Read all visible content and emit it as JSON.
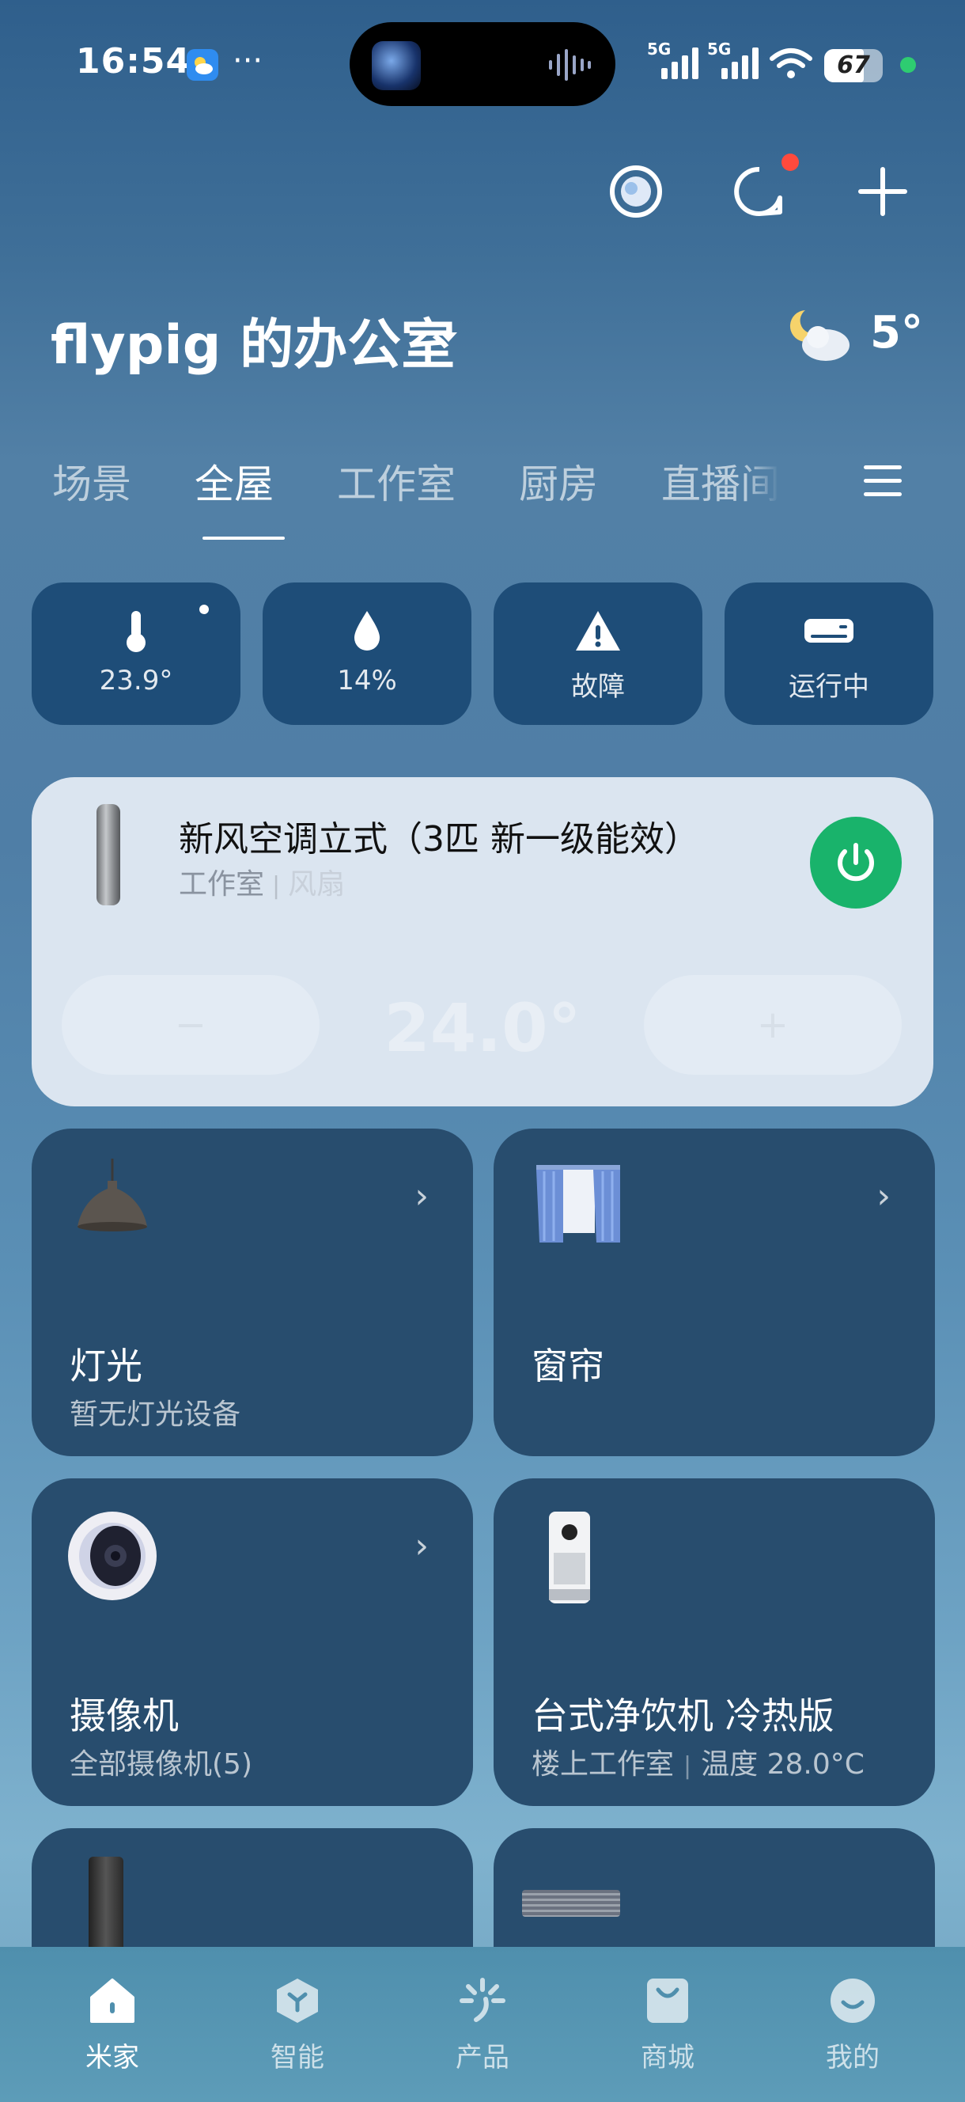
{
  "status_bar": {
    "time": "16:54",
    "dots": "···",
    "net1": "5G",
    "net2": "5G",
    "battery": "67"
  },
  "header": {
    "home_name": "flypig 的办公室",
    "outdoor_temp": "5°"
  },
  "tabs": [
    {
      "label": "场景",
      "active": false
    },
    {
      "label": "全屋",
      "active": true
    },
    {
      "label": "工作室",
      "active": false
    },
    {
      "label": "厨房",
      "active": false
    },
    {
      "label": "直播间",
      "active": false
    }
  ],
  "stats": [
    {
      "icon": "thermometer-icon",
      "value": "23.9°"
    },
    {
      "icon": "humidity-drop-icon",
      "value": "14%"
    },
    {
      "icon": "warning-icon",
      "value": "故障"
    },
    {
      "icon": "air-conditioner-icon",
      "value": "运行中"
    }
  ],
  "ac_card": {
    "name": "新风空调立式（3匹 新一级能效）",
    "room": "工作室",
    "mode": "风扇",
    "minus": "−",
    "plus": "+",
    "temperature": "24.0°",
    "power_color": "#19b36b"
  },
  "tiles": [
    {
      "name": "灯光",
      "sub": "暂无灯光设备",
      "icon": "pendant-lamp-icon"
    },
    {
      "name": "窗帘",
      "sub": "",
      "icon": "curtain-icon"
    },
    {
      "name": "摄像机",
      "sub": "全部摄像机(5)",
      "icon": "camera-icon"
    },
    {
      "name": "台式净饮机 冷热版",
      "room": "楼上工作室",
      "detail": "温度 28.0°C",
      "icon": "water-purifier-icon"
    }
  ],
  "nav": [
    {
      "label": "米家",
      "icon": "home-icon",
      "active": true
    },
    {
      "label": "智能",
      "icon": "smart-icon",
      "active": false
    },
    {
      "label": "产品",
      "icon": "product-icon",
      "active": false
    },
    {
      "label": "商城",
      "icon": "shop-icon",
      "active": false
    },
    {
      "label": "我的",
      "icon": "profile-icon",
      "active": false
    }
  ]
}
